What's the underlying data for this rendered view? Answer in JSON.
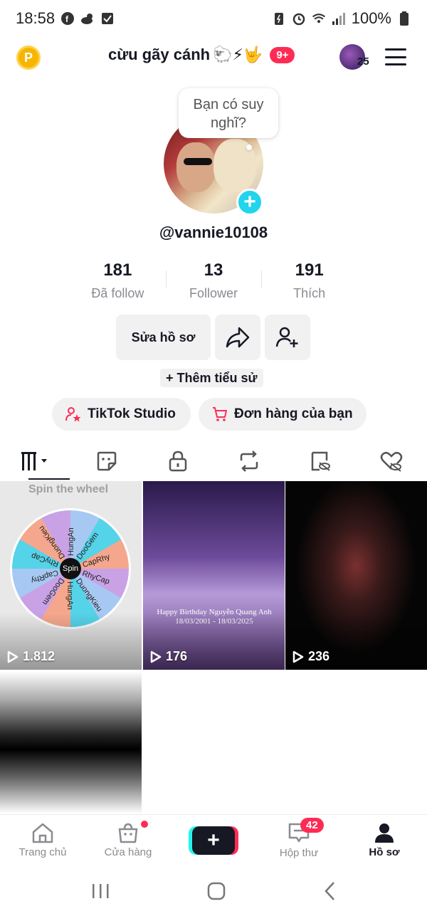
{
  "status_bar": {
    "time": "18:58",
    "battery": "100%"
  },
  "header": {
    "profile_name": "cừu gãy cánh",
    "name_emojis": "🐑⚡🤟",
    "notification_badge": "9+",
    "account_count": "25"
  },
  "profile": {
    "thought_bubble": "Bạn có suy nghĩ?",
    "username": "@vannie10108",
    "stats": [
      {
        "value": "181",
        "label": "Đã follow"
      },
      {
        "value": "13",
        "label": "Follower"
      },
      {
        "value": "191",
        "label": "Thích"
      }
    ],
    "edit_profile_label": "Sửa hồ sơ",
    "add_bio_label": "+ Thêm tiểu sử",
    "studio_label": "TikTok Studio",
    "orders_label": "Đơn hàng của bạn"
  },
  "tabs": [
    {
      "icon": "videos-grid-icon"
    },
    {
      "icon": "sticker-icon"
    },
    {
      "icon": "lock-icon"
    },
    {
      "icon": "repost-icon"
    },
    {
      "icon": "hidden-tag-icon"
    },
    {
      "icon": "liked-hidden-icon"
    }
  ],
  "videos": [
    {
      "views": "1.812",
      "overlay_title": "Spin the wheel"
    },
    {
      "views": "176",
      "overlay_text": "Happy Birthday Nguyễn Quang Anh\n18/03/2001 - 18/03/2025"
    },
    {
      "views": "236"
    },
    {
      "views": ""
    }
  ],
  "wheel_labels": [
    "HungAn",
    "DooGem",
    "CapRhy",
    "RhyCap",
    "DuongKieu",
    "HungAn",
    "DooGem",
    "CapRhy",
    "RhyCap",
    "DuongKieu",
    "Spin"
  ],
  "bottom_nav": {
    "home": "Trang chủ",
    "shop": "Cửa hàng",
    "inbox": "Hộp thư",
    "inbox_badge": "42",
    "profile": "Hồ sơ"
  },
  "colors": {
    "accent_red": "#fe2c55",
    "accent_cyan": "#20d5ec",
    "text_primary": "#161823",
    "text_secondary": "#8a8b91"
  }
}
